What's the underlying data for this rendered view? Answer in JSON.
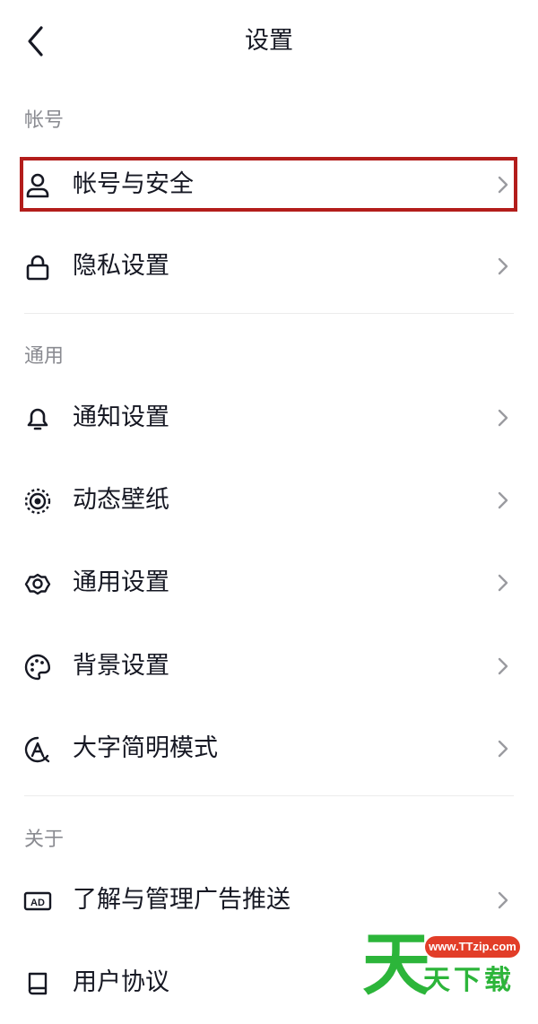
{
  "header": {
    "title": "设置",
    "back_icon": "chevron-left-icon"
  },
  "sections": {
    "account": {
      "label": "帐号",
      "items": [
        {
          "label": "帐号与安全",
          "icon": "user-icon"
        },
        {
          "label": "隐私设置",
          "icon": "lock-icon"
        }
      ]
    },
    "general": {
      "label": "通用",
      "items": [
        {
          "label": "通知设置",
          "icon": "bell-icon"
        },
        {
          "label": "动态壁纸",
          "icon": "live-wallpaper-icon"
        },
        {
          "label": "通用设置",
          "icon": "gear-icon"
        },
        {
          "label": "背景设置",
          "icon": "palette-icon"
        },
        {
          "label": "大字简明模式",
          "icon": "large-font-icon"
        }
      ]
    },
    "about": {
      "label": "关于",
      "items": [
        {
          "label": "了解与管理广告推送",
          "icon": "ad-icon"
        },
        {
          "label": "用户协议",
          "icon": "book-icon"
        }
      ]
    }
  },
  "highlight": {
    "color": "#b31d1b",
    "target": "帐号与安全"
  },
  "watermark": {
    "site": "www.TTzip.com",
    "big_char": "天",
    "text": "天下载"
  }
}
